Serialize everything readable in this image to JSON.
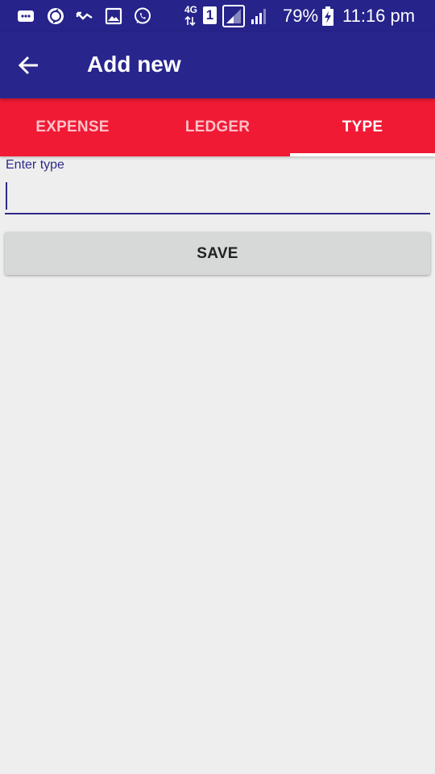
{
  "status_bar": {
    "icons": [
      "messages-icon",
      "sync-icon",
      "missed-call-icon",
      "gallery-icon",
      "whatsapp-icon",
      "network-4g-icon",
      "sim-1-icon",
      "signal-sim1-icon",
      "signal-sim2-icon",
      "battery-charging-icon"
    ],
    "network_label": "4G",
    "sim_label": "1",
    "battery": "79%",
    "time": "11:16 pm"
  },
  "app_bar": {
    "title": "Add new",
    "back_icon": "arrow-back-icon"
  },
  "tabs": [
    {
      "label": "EXPENSE",
      "active": false
    },
    {
      "label": "LEDGER",
      "active": false
    },
    {
      "label": "TYPE",
      "active": true
    }
  ],
  "form": {
    "type_label": "Enter type",
    "type_value": "",
    "save_label": "SAVE"
  },
  "colors": {
    "status_bar": "#26238a",
    "app_bar": "#28268c",
    "tab_bar": "#f01a35",
    "accent": "#2e2a8a",
    "background": "#eeeeee",
    "button": "#d7d8d8"
  }
}
